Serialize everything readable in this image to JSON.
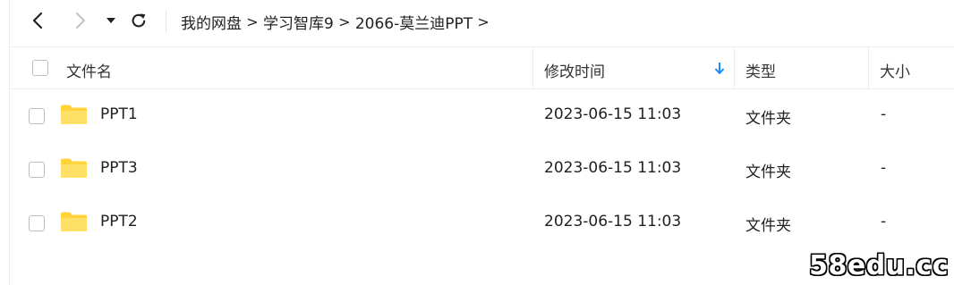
{
  "toolbar": {
    "back_icon": "chevron-left-icon",
    "forward_icon": "chevron-right-icon",
    "dropdown_icon": "caret-down-icon",
    "refresh_icon": "refresh-icon"
  },
  "breadcrumb": {
    "items": [
      "我的网盘",
      "学习智库9",
      "2066-莫兰迪PPT"
    ],
    "separator": ">"
  },
  "table": {
    "columns": {
      "name": "文件名",
      "modified": "修改时间",
      "type": "类型",
      "size": "大小"
    },
    "sort": {
      "column": "modified",
      "direction": "descending",
      "icon": "arrow-down-icon",
      "color": "#1a8cff"
    },
    "rows": [
      {
        "name": "PPT1",
        "modified": "2023-06-15 11:03",
        "type": "文件夹",
        "size": "-"
      },
      {
        "name": "PPT3",
        "modified": "2023-06-15 11:03",
        "type": "文件夹",
        "size": "-"
      },
      {
        "name": "PPT2",
        "modified": "2023-06-15 11:03",
        "type": "文件夹",
        "size": "-"
      }
    ]
  },
  "folder_color": "#ffd43b",
  "watermark": "58edu.cc"
}
